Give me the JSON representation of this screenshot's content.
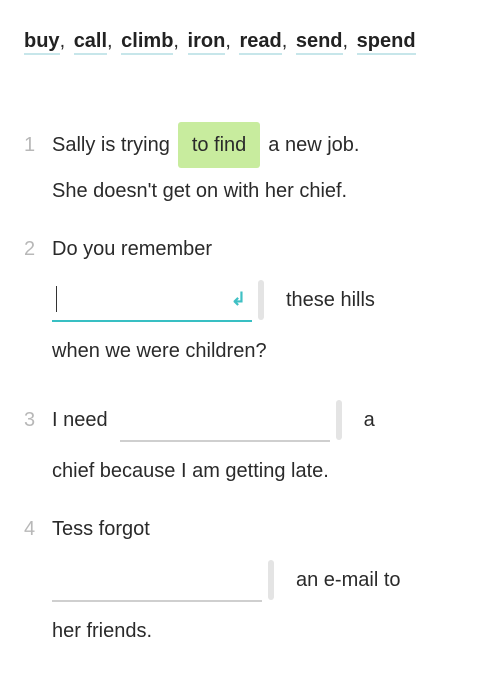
{
  "word_bank": [
    "buy",
    "call",
    "climb",
    "iron",
    "read",
    "send",
    "spend"
  ],
  "items": [
    {
      "num": "1",
      "before": "Sally is trying",
      "answer": "to find",
      "after": "a new job.",
      "line2": "She doesn't get on with her chief."
    },
    {
      "num": "2",
      "before": "Do you remember",
      "after": "these hills",
      "line2": "when we were children?"
    },
    {
      "num": "3",
      "before": "I need",
      "after": "a",
      "line2": "chief because I am getting late."
    },
    {
      "num": "4",
      "before": "Tess forgot",
      "after": "an e-mail to",
      "line2": "her friends."
    }
  ]
}
